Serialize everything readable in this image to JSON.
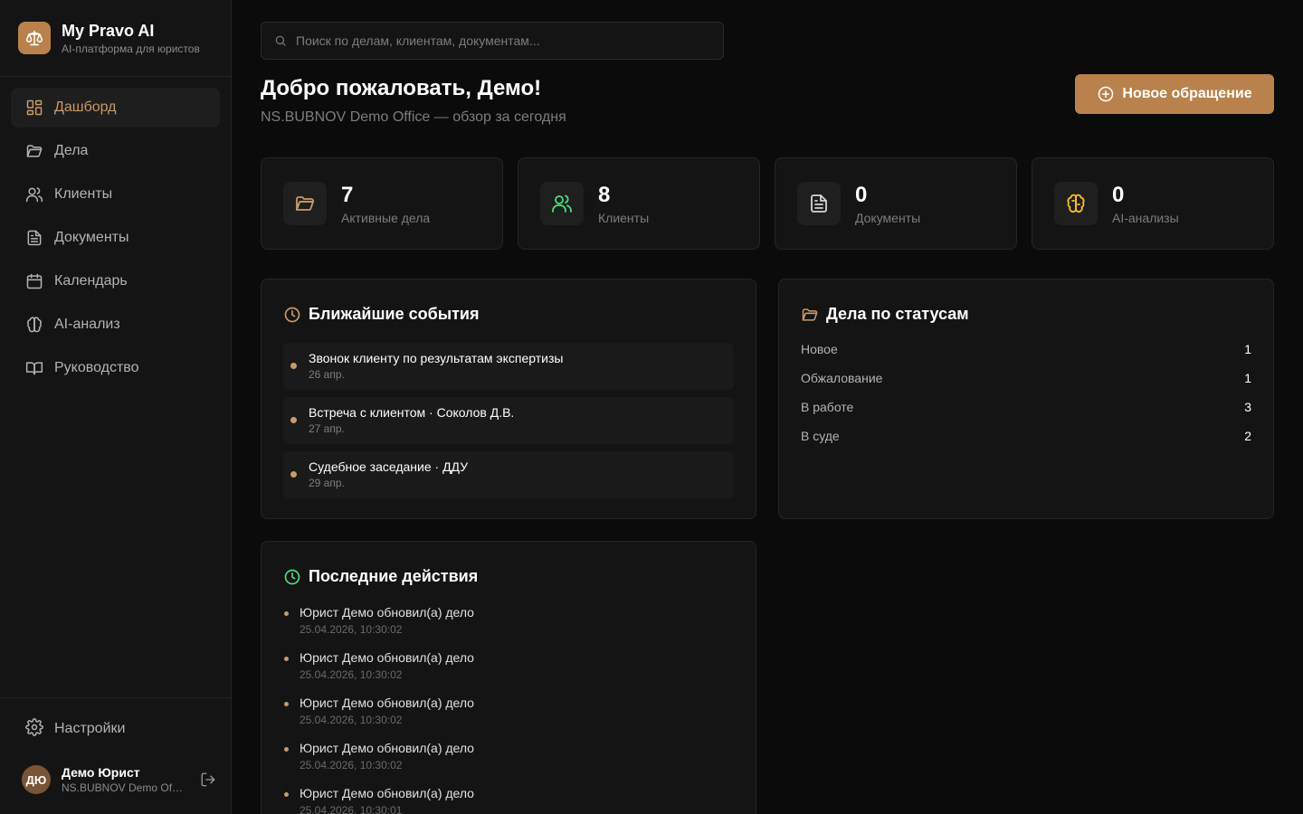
{
  "brand": {
    "title": "My Pravo AI",
    "subtitle": "AI-платформа для юристов"
  },
  "sidebar": {
    "items": [
      {
        "label": "Дашборд",
        "icon": "dashboard-icon",
        "active": true
      },
      {
        "label": "Дела",
        "icon": "folder-icon"
      },
      {
        "label": "Клиенты",
        "icon": "users-icon"
      },
      {
        "label": "Документы",
        "icon": "document-icon"
      },
      {
        "label": "Календарь",
        "icon": "calendar-icon"
      },
      {
        "label": "AI-анализ",
        "icon": "brain-icon"
      },
      {
        "label": "Руководство",
        "icon": "book-icon"
      }
    ],
    "settings_label": "Настройки"
  },
  "user": {
    "initials": "ДЮ",
    "name": "Демо Юрист",
    "org": "NS.BUBNOV Demo Office"
  },
  "search": {
    "placeholder": "Поиск по делам, клиентам, документам..."
  },
  "header": {
    "title": "Добро пожаловать, Демо!",
    "subtitle": "NS.BUBNOV Demo Office — обзор за сегодня",
    "new_button": "Новое обращение"
  },
  "stats": [
    {
      "value": "7",
      "label": "Активные дела",
      "icon": "folder-icon",
      "color": "#c99a6a"
    },
    {
      "value": "8",
      "label": "Клиенты",
      "icon": "users-icon",
      "color": "#4ade80"
    },
    {
      "value": "0",
      "label": "Документы",
      "icon": "document-icon",
      "color": "#d4d4d4"
    },
    {
      "value": "0",
      "label": "AI-анализы",
      "icon": "brain-icon",
      "color": "#fbbf24"
    }
  ],
  "events": {
    "title": "Ближайшие события",
    "items": [
      {
        "title": "Звонок клиенту по результатам экспертизы",
        "date": "26 апр."
      },
      {
        "title": "Встреча с клиентом · Соколов Д.В.",
        "date": "27 апр."
      },
      {
        "title": "Судебное заседание · ДДУ",
        "date": "29 апр."
      }
    ]
  },
  "statuses": {
    "title": "Дела по статусам",
    "items": [
      {
        "name": "Новое",
        "count": "1"
      },
      {
        "name": "Обжалование",
        "count": "1"
      },
      {
        "name": "В работе",
        "count": "3"
      },
      {
        "name": "В суде",
        "count": "2"
      }
    ]
  },
  "activity": {
    "title": "Последние действия",
    "items": [
      {
        "title": "Юрист Демо обновил(а) дело",
        "time": "25.04.2026, 10:30:02"
      },
      {
        "title": "Юрист Демо обновил(а) дело",
        "time": "25.04.2026, 10:30:02"
      },
      {
        "title": "Юрист Демо обновил(а) дело",
        "time": "25.04.2026, 10:30:02"
      },
      {
        "title": "Юрист Демо обновил(а) дело",
        "time": "25.04.2026, 10:30:02"
      },
      {
        "title": "Юрист Демо обновил(а) дело",
        "time": "25.04.2026, 10:30:01"
      }
    ]
  },
  "colors": {
    "accent": "#b9824c",
    "accent_text": "#c99a6a",
    "success": "#4ade80",
    "warning": "#fbbf24"
  }
}
